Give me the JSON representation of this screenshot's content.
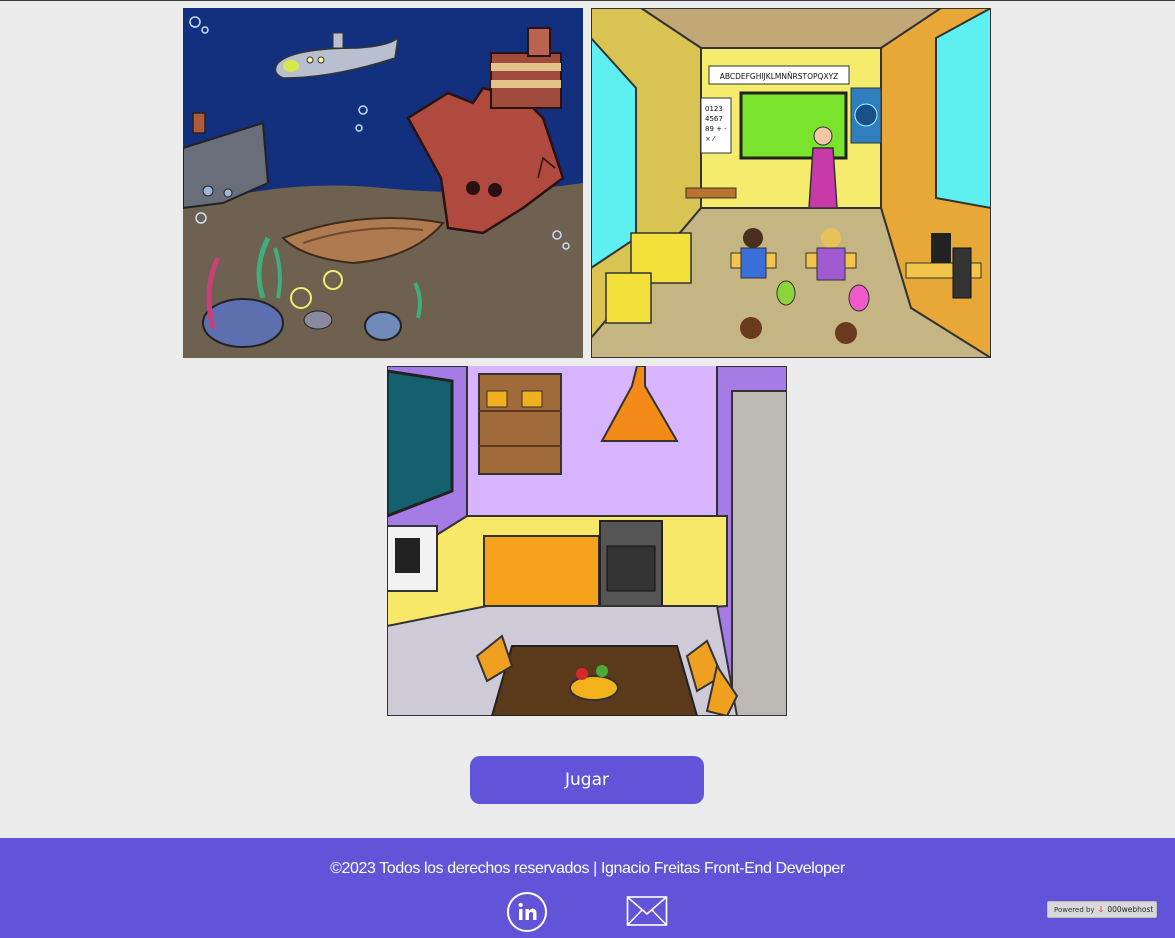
{
  "gallery": {
    "scenes": [
      {
        "name": "ocean-floor"
      },
      {
        "name": "classroom",
        "blackboard_text": "ABCDEFGHIJKLMNÑRSTOPQXYZ",
        "numbers_chart": [
          "0123",
          "4567",
          "89 + -",
          "× ⁄"
        ]
      },
      {
        "name": "kitchen"
      }
    ]
  },
  "actions": {
    "play_label": "Jugar"
  },
  "footer": {
    "copyright": "©2023 Todos los derechos reservados | Ignacio Freitas Front-End Developer",
    "linkedin_icon": "linkedin-icon",
    "mail_icon": "mail-icon",
    "powered_by": "Powered by",
    "host_brand": "000webhost"
  },
  "colors": {
    "accent": "#6254d8",
    "background": "#ececec"
  }
}
